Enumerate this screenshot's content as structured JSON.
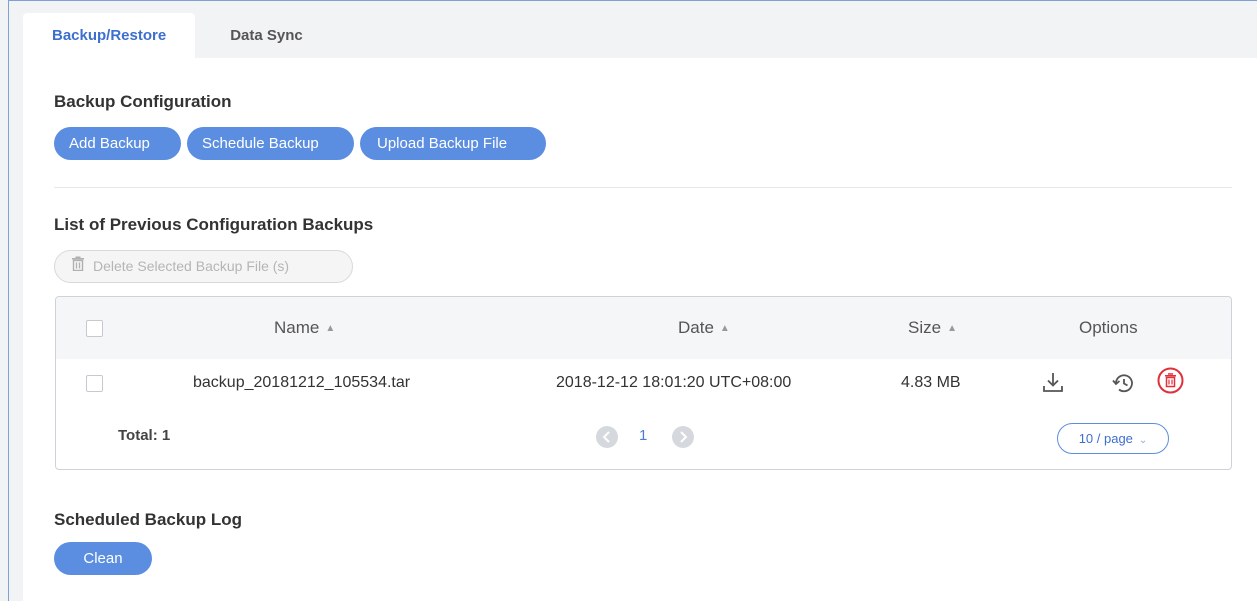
{
  "tabs": [
    {
      "label": "Backup/Restore",
      "active": true
    },
    {
      "label": "Data Sync",
      "active": false
    }
  ],
  "backup_config": {
    "title": "Backup Configuration",
    "buttons": {
      "add": "Add Backup",
      "schedule": "Schedule Backup",
      "upload": "Upload Backup File"
    }
  },
  "backup_list": {
    "title": "List of Previous Configuration Backups",
    "delete_selected_label": "Delete Selected Backup File (s)",
    "columns": {
      "name": "Name",
      "date": "Date",
      "size": "Size",
      "options": "Options"
    },
    "rows": [
      {
        "name": "backup_20181212_105534.tar",
        "date": "2018-12-12 18:01:20 UTC+08:00",
        "size": "4.83 MB",
        "option_icons": [
          "download-icon",
          "restore-icon",
          "delete-icon"
        ]
      }
    ],
    "pagination": {
      "total_label": "Total: 1",
      "current_page": "1",
      "page_size": "10 / page"
    }
  },
  "scheduled_log": {
    "title": "Scheduled Backup Log",
    "clean_label": "Clean"
  },
  "colors": {
    "accent": "#5b8ee0",
    "tab_active_text": "#3d6fcf",
    "delete_red": "#e0303a",
    "disabled_bg": "#f5f5f5"
  }
}
